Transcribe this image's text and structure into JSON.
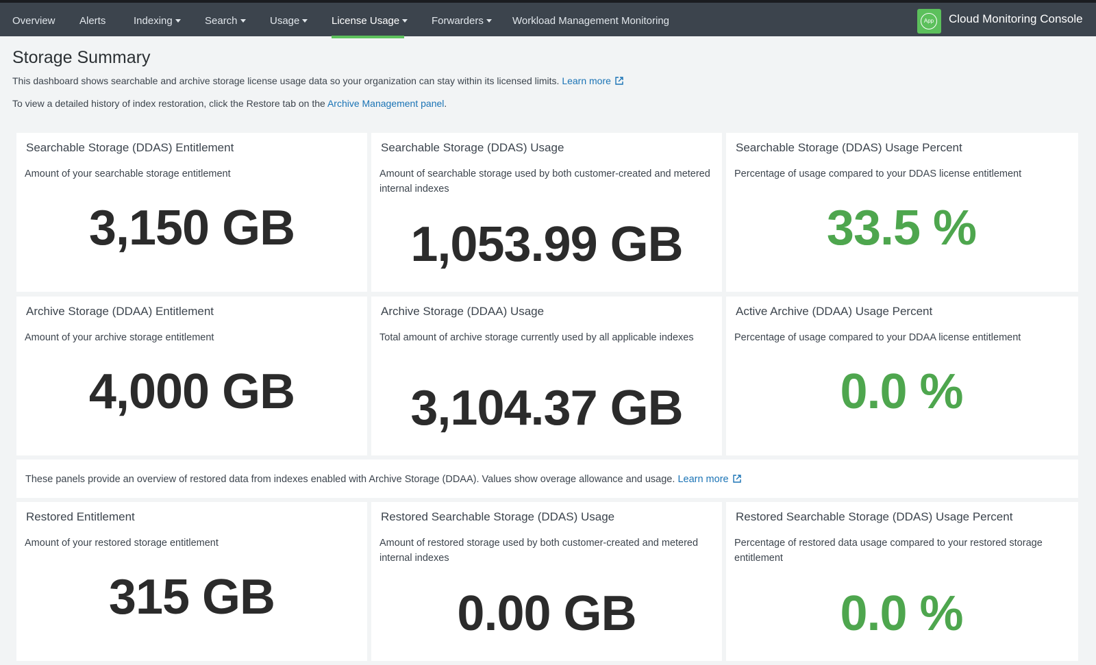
{
  "nav": {
    "items": [
      {
        "label": "Overview",
        "dropdown": false
      },
      {
        "label": "Alerts",
        "dropdown": false
      },
      {
        "label": "Indexing",
        "dropdown": true
      },
      {
        "label": "Search",
        "dropdown": true
      },
      {
        "label": "Usage",
        "dropdown": true
      },
      {
        "label": "License Usage",
        "dropdown": true,
        "active": true
      },
      {
        "label": "Forwarders",
        "dropdown": true
      },
      {
        "label": "Workload Management Monitoring",
        "dropdown": false
      }
    ],
    "app_badge": "App",
    "app_title": "Cloud Monitoring Console"
  },
  "page": {
    "title": "Storage Summary",
    "desc1": "This dashboard shows searchable and archive storage license usage data so your organization can stay within its licensed limits.",
    "desc1_link": "Learn more",
    "desc2_prefix": "To view a detailed history of index restoration, click the Restore tab on the",
    "desc2_link": "Archive Management panel",
    "desc2_suffix": "."
  },
  "panels": {
    "ddas_entitlement": {
      "title": "Searchable Storage (DDAS) Entitlement",
      "subtitle": "Amount of your searchable storage entitlement",
      "value": "3,150 GB"
    },
    "ddas_usage": {
      "title": "Searchable Storage (DDAS) Usage",
      "subtitle": "Amount of searchable storage used by both customer-created and metered internal indexes",
      "value": "1,053.99 GB"
    },
    "ddas_percent": {
      "title": "Searchable Storage (DDAS) Usage Percent",
      "subtitle": "Percentage of usage compared to your DDAS license entitlement",
      "value": "33.5 %"
    },
    "ddaa_entitlement": {
      "title": "Archive Storage (DDAA) Entitlement",
      "subtitle": "Amount of your archive storage entitlement",
      "value": "4,000 GB"
    },
    "ddaa_usage": {
      "title": "Archive Storage (DDAA) Usage",
      "subtitle": "Total amount of archive storage currently used by all applicable indexes",
      "value": "3,104.37 GB"
    },
    "ddaa_percent": {
      "title": "Active Archive (DDAA) Usage Percent",
      "subtitle": "Percentage of usage compared to your DDAA license entitlement",
      "value": "0.0 %"
    },
    "restored_entitlement": {
      "title": "Restored Entitlement",
      "subtitle": "Amount of your restored storage entitlement",
      "value": "315 GB"
    },
    "restored_usage": {
      "title": "Restored Searchable Storage (DDAS) Usage",
      "subtitle": "Amount of restored storage used by both customer-created and metered internal indexes",
      "value": "0.00 GB"
    },
    "restored_percent": {
      "title": "Restored Searchable Storage (DDAS) Usage Percent",
      "subtitle": "Percentage of restored data usage compared to your restored storage entitlement",
      "value": "0.0 %"
    }
  },
  "info": {
    "text": "These panels provide an overview of restored data from indexes enabled with Archive Storage (DDAA). Values show overage allowance and usage.",
    "link": "Learn more"
  },
  "colors": {
    "nav_bg": "#3c444d",
    "accent_green": "#5cc05c",
    "value_green": "#4ea64e",
    "link_blue": "#1a73b5"
  }
}
